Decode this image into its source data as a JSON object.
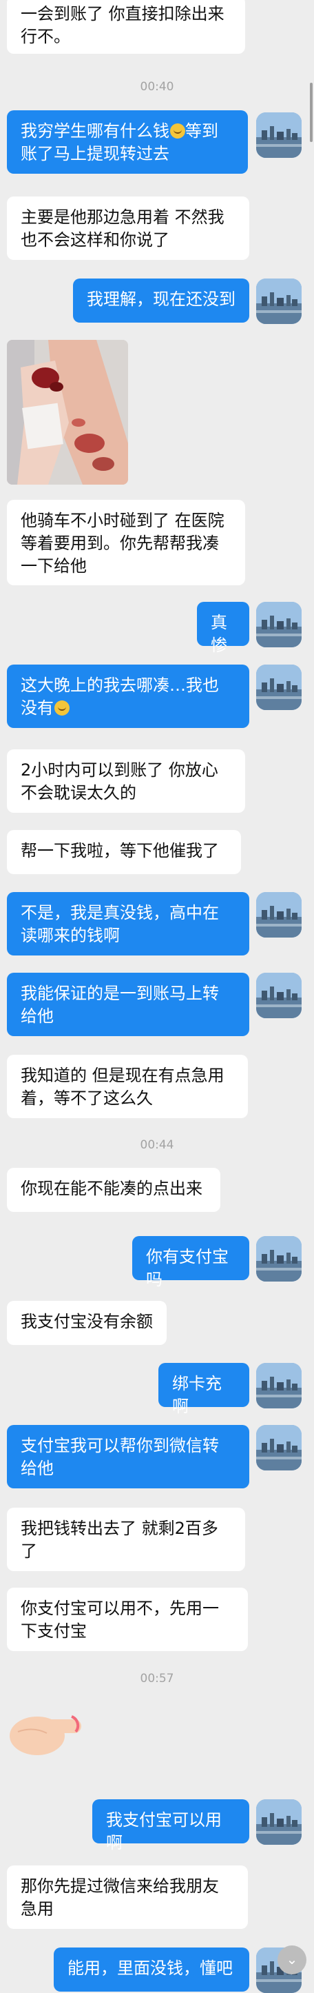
{
  "timestamps": [
    "00:40",
    "00:44",
    "00:57"
  ],
  "messages": {
    "m1_line1": "一会到账了 你直接扣除出来",
    "m1_line2": "行不。",
    "m2_line1a": "我穷学生哪有什么钱",
    "m2_line1b": "等到",
    "m2_line2": "账了马上提现转过去",
    "m3_line1": "主要是他那边急用着 不然我",
    "m3_line2": "也不会这样和你说了",
    "m4": "我理解，现在还没到",
    "m5_line1": "他骑车不小时碰到了  在医院",
    "m5_line2": "等着要用到。你先帮帮我凑",
    "m5_line3": "一下给他",
    "m6": "真惨",
    "m7_line1": "这大晚上的我去哪凑…我也",
    "m7_line2": "没有",
    "m8_line1": "2小时内可以到账了 你放心",
    "m8_line2": "不会耽误太久的",
    "m9": "帮一下我啦，等下他催我了",
    "m10_line1": "不是，我是真没钱，高中在",
    "m10_line2": "读哪来的钱啊",
    "m11_line1": "我能保证的是一到账马上转",
    "m11_line2": "给他",
    "m12_line1": "我知道的 但是现在有点急用",
    "m12_line2": "着，等不了这么久",
    "m13": "你现在能不能凑的点出来",
    "m14": "你有支付宝吗",
    "m15": "我支付宝没有余额",
    "m16": "绑卡充啊",
    "m17_line1": "支付宝我可以帮你到微信转",
    "m17_line2": "给他",
    "m18_line1": "我把钱转出去了 就剩2百多",
    "m18_line2": "了",
    "m19_line1": "你支付宝可以用不，先用一",
    "m19_line2": "下支付宝",
    "m20": "我支付宝可以用啊",
    "m21_line1": "那你先提过微信来给我朋友",
    "m21_line2": "急用",
    "m22": "能用，里面没钱，懂吧"
  },
  "icons": {
    "emoji": "grinning-sweat-emoji",
    "sticker": "pointing-hand-sticker",
    "scroll_down": "chevron-down-icon",
    "avatar": "avatar-city-skyline"
  },
  "colors": {
    "background": "#ededed",
    "sent_bubble": "#1e88f0",
    "received_bubble": "#ffffff",
    "timestamp": "#a3a3a3"
  }
}
